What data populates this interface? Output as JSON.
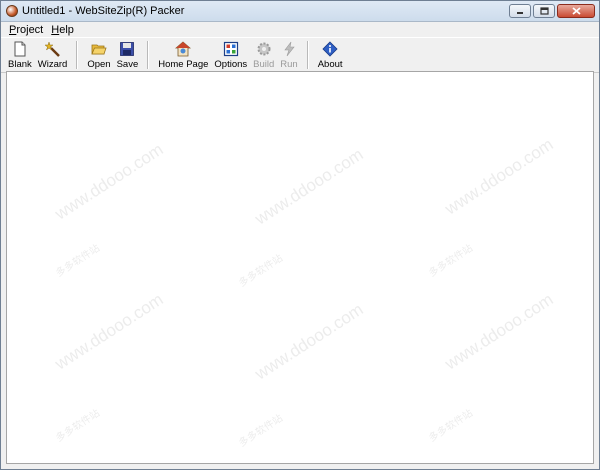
{
  "window": {
    "title": "Untitled1 - WebSiteZip(R) Packer"
  },
  "menu": [
    {
      "label": "Project",
      "accel": "P",
      "rest": "roject"
    },
    {
      "label": "Help",
      "accel": "H",
      "rest": "elp"
    }
  ],
  "toolbar": {
    "blank": "Blank",
    "wizard": "Wizard",
    "open": "Open",
    "save": "Save",
    "home_page": "Home Page",
    "options": "Options",
    "build": "Build",
    "run": "Run",
    "about": "About"
  },
  "watermark": {
    "url": "www.ddooo.com",
    "cn": "多多软件站"
  }
}
